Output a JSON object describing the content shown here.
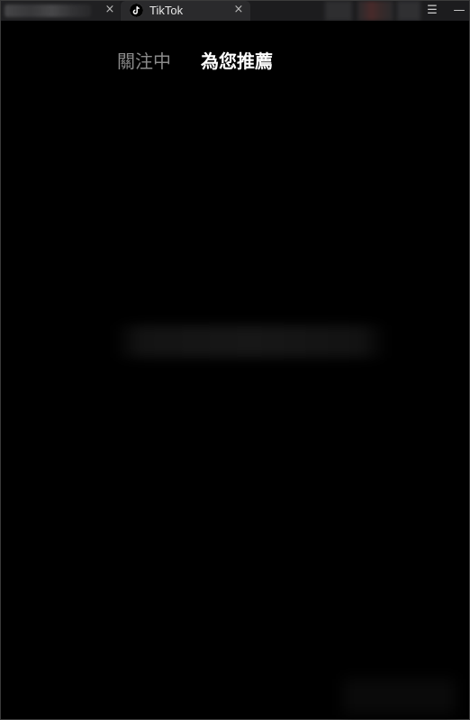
{
  "browser": {
    "active_tab": {
      "title": "TikTok",
      "close_glyph": "×",
      "icon": "tiktok-logo-icon"
    },
    "inactive_tab": {
      "close_glyph": "×"
    },
    "window_controls": {
      "menu_glyph": "☰",
      "minimize_glyph": "—"
    }
  },
  "feed": {
    "tabs": [
      {
        "label": "關注中",
        "selected": false
      },
      {
        "label": "為您推薦",
        "selected": true
      }
    ]
  },
  "colors": {
    "background": "#000000",
    "tab_selected": "#ffffff",
    "tab_unselected": "#8a8a8a"
  }
}
